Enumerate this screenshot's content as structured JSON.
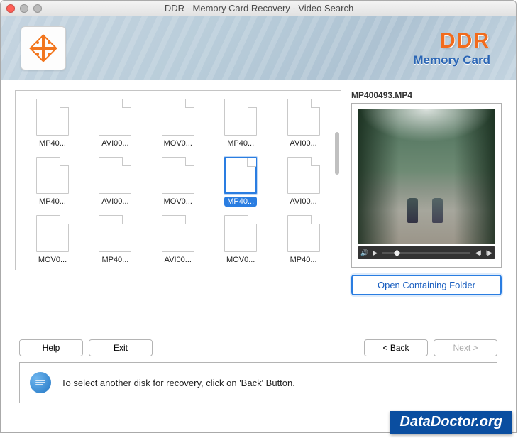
{
  "window": {
    "title": "DDR - Memory Card Recovery - Video Search"
  },
  "brand": {
    "name": "DDR",
    "subtitle": "Memory Card"
  },
  "files": [
    {
      "label": "MP40..."
    },
    {
      "label": "AVI00..."
    },
    {
      "label": "MOV0..."
    },
    {
      "label": "MP40..."
    },
    {
      "label": "AVI00..."
    },
    {
      "label": "MP40..."
    },
    {
      "label": "AVI00..."
    },
    {
      "label": "MOV0..."
    },
    {
      "label": "MP40...",
      "selected": true
    },
    {
      "label": "AVI00..."
    },
    {
      "label": "MOV0..."
    },
    {
      "label": "MP40..."
    },
    {
      "label": "AVI00..."
    },
    {
      "label": "MOV0..."
    },
    {
      "label": "MP40..."
    }
  ],
  "preview": {
    "filename": "MP400493.MP4"
  },
  "buttons": {
    "open_folder": "Open Containing Folder",
    "help": "Help",
    "exit": "Exit",
    "back": "< Back",
    "next": "Next >"
  },
  "info": {
    "text": "To select another disk for recovery, click on 'Back' Button."
  },
  "watermark": "DataDoctor.org"
}
